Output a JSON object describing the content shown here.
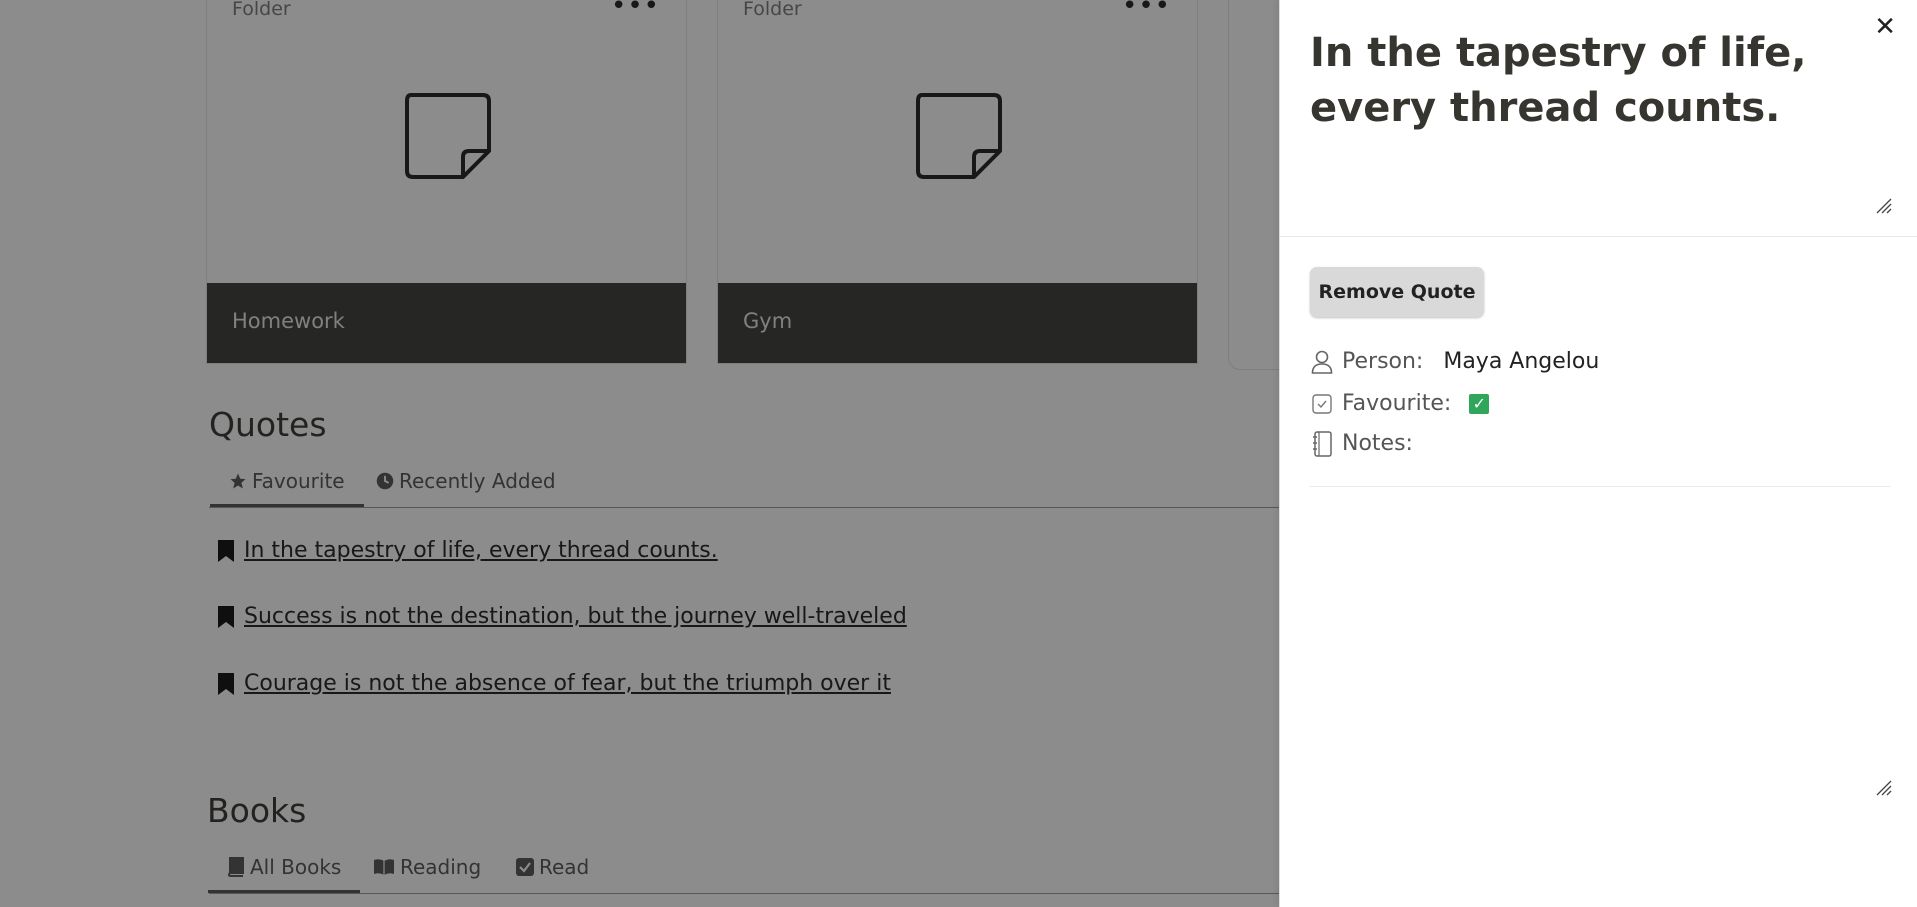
{
  "folders": [
    {
      "label": "Folder",
      "name": "Homework"
    },
    {
      "label": "Folder",
      "name": "Gym"
    }
  ],
  "quotes_section": {
    "title": "Quotes",
    "tabs": [
      {
        "label": "Favourite",
        "icon": "star-icon"
      },
      {
        "label": "Recently Added",
        "icon": "clock-icon"
      }
    ],
    "items": [
      "In the tapestry of life, every thread counts.",
      "Success is not the destination, but the journey well-traveled",
      "Courage is not the absence of fear, but the triumph over it"
    ]
  },
  "books_section": {
    "title": "Books",
    "tabs": [
      {
        "label": "All Books",
        "icon": "book-icon"
      },
      {
        "label": "Reading",
        "icon": "open-book-icon"
      },
      {
        "label": "Read",
        "icon": "check-square-icon"
      }
    ]
  },
  "panel": {
    "title": "In the tapestry of life, every thread counts.",
    "remove_button": "Remove Quote",
    "properties": {
      "person_label": "Person:",
      "person_value": "Maya Angelou",
      "favourite_label": "Favourite:",
      "favourite_checked": true,
      "notes_label": "Notes:"
    }
  },
  "colors": {
    "check_green": "#2fa65a",
    "card_footer": "#3d3c38"
  }
}
